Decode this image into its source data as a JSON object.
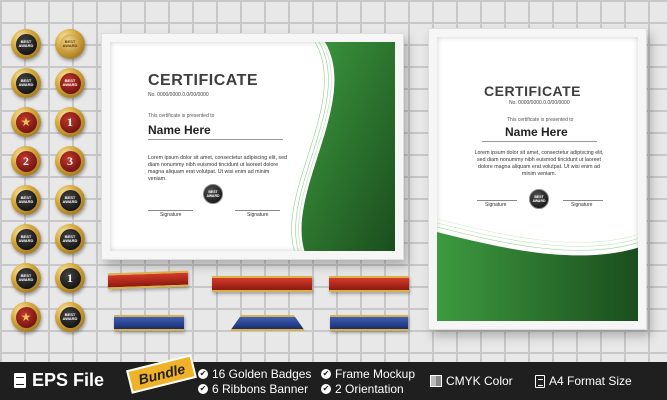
{
  "landscape_cert": {
    "title": "CERTIFICATE",
    "number": "No. 0000/0000.0.0/00/0000",
    "presented": "This certificate is presented to",
    "name": "Name Here",
    "body": "Lorem ipsum dolor sit amet, consectetur adipiscing elit, sed diam nonummy nibh euismod tincidunt ut laoreet dolore magna aliquam erat volutpat. Ut wisi enim ad minim veniam.",
    "signature_left": "Signature",
    "signature_right": "Signature",
    "medal": [
      "BEST",
      "AWARD"
    ]
  },
  "portrait_cert": {
    "title": "CERTIFICATE",
    "number": "No. 0000/0000.0.0/00/0000",
    "presented": "This certificate is presented to",
    "name": "Name Here",
    "body": "Lorem ipsum dolor sit amet, consectetur adipiscing elit, sed diam nonummy nibh euismod tincidunt ut laoreet dolore magna aliquam erat volutpat. Ut wisi enim ad minim veniam.",
    "signature_left": "Signature",
    "signature_right": "Signature",
    "medal": [
      "BEST",
      "AWARD"
    ]
  },
  "badges": [
    {
      "type": "dark",
      "text": [
        "BEST",
        "AWARD"
      ]
    },
    {
      "type": "gold",
      "text": [
        "BEST",
        "AWARD"
      ]
    },
    {
      "type": "dark",
      "text": [
        "BEST",
        "AWARD"
      ]
    },
    {
      "type": "red",
      "text": [
        "BEST",
        "AWARD"
      ]
    },
    {
      "type": "red",
      "star": "★"
    },
    {
      "type": "red",
      "num": "1"
    },
    {
      "type": "red",
      "num": "2"
    },
    {
      "type": "red",
      "num": "3"
    },
    {
      "type": "dark",
      "text": [
        "BEST",
        "AWARD"
      ]
    },
    {
      "type": "dark",
      "text": [
        "BEST",
        "AWARD"
      ]
    },
    {
      "type": "dark",
      "text": [
        "BEST",
        "AWARD"
      ]
    },
    {
      "type": "dark",
      "text": [
        "BEST",
        "AWARD"
      ]
    },
    {
      "type": "dark",
      "text": [
        "BEST",
        "AWARD"
      ]
    },
    {
      "type": "dark",
      "num": "1"
    },
    {
      "type": "red",
      "star": "★"
    },
    {
      "type": "dark",
      "text": [
        "BEST",
        "AWARD"
      ]
    }
  ],
  "bottom": {
    "eps_label": "EPS File",
    "bundle_label": "Bundle",
    "feat1": "16 Golden Badges",
    "feat2": "6  Ribbons Banner",
    "feat3": "Frame Mockup",
    "feat4": "2 Orientation",
    "cmyk": "CMYK Color",
    "a4": "A4 Format Size"
  },
  "colors": {
    "green_dark": "#1f5a23",
    "green_light": "#3d9a3f",
    "gold": "#d4a73c",
    "bar_bg": "#1f1f1f",
    "bundle": "#f0b228"
  },
  "icons": [
    "document-icon",
    "check-icon",
    "cmyk-swatch-icon",
    "a4-page-icon",
    "star-icon"
  ]
}
